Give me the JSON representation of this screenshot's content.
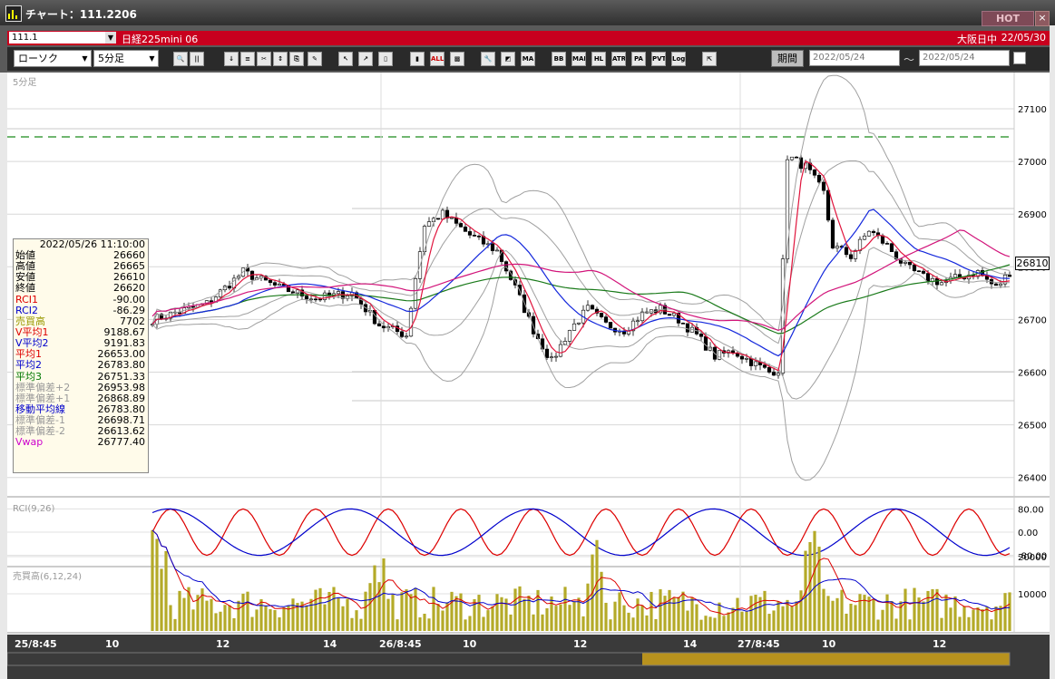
{
  "window": {
    "title": "チャート：111.2206",
    "hot_label": "HOT",
    "close_glyph": "×"
  },
  "symbol_bar": {
    "code": "111.1",
    "name": "日経225mini 06",
    "market": "大阪日中",
    "date": "22/05/30"
  },
  "toolbar": {
    "chart_type": "ローソク",
    "interval": "5分足",
    "buttons": [
      {
        "name": "zoom-icon",
        "label": "🔍"
      },
      {
        "name": "bar-width-icon",
        "label": "||"
      },
      {
        "name": "draw-down-icon",
        "label": "↓"
      },
      {
        "name": "scale-icon",
        "label": "≡"
      },
      {
        "name": "cut-icon",
        "label": "✂"
      },
      {
        "name": "mark-icon",
        "label": "↕"
      },
      {
        "name": "copy-icon",
        "label": "⎘"
      },
      {
        "name": "pencil-icon",
        "label": "✎"
      },
      {
        "name": "cursor-icon",
        "label": "↖"
      },
      {
        "name": "arrow-icon",
        "label": "↗"
      },
      {
        "name": "candle-a-icon",
        "label": "▯"
      },
      {
        "name": "candle-b-icon",
        "label": "▮"
      },
      {
        "name": "all-button",
        "label": "ALL"
      },
      {
        "name": "pattern-icon",
        "label": "▩"
      },
      {
        "name": "wrench-icon",
        "label": "🔧"
      },
      {
        "name": "color-icon",
        "label": "◩"
      },
      {
        "name": "ma-button",
        "label": "MA"
      },
      {
        "name": "bb-button",
        "label": "BB"
      },
      {
        "name": "mae-button",
        "label": "MAE"
      },
      {
        "name": "hl-button",
        "label": "HL"
      },
      {
        "name": "atr-button",
        "label": "ATR"
      },
      {
        "name": "para-button",
        "label": "PA"
      },
      {
        "name": "pvt-button",
        "label": "PVT"
      },
      {
        "name": "log-button",
        "label": "Log"
      },
      {
        "name": "export-icon",
        "label": "⇱"
      }
    ],
    "period_label": "期間",
    "date_from": "2022/05/24",
    "date_to": "2022/05/24",
    "tilde": "～"
  },
  "main_panel": {
    "label": "5分足",
    "price_ticks": [
      "27100",
      "27000",
      "26900",
      "26800",
      "26700",
      "26600",
      "26500",
      "26400"
    ],
    "current_price": "26810"
  },
  "info_box": {
    "datetime": "2022/05/26 11:10:00",
    "rows": [
      {
        "label": "始値",
        "value": "26660",
        "color": "#000000"
      },
      {
        "label": "高値",
        "value": "26665",
        "color": "#000000"
      },
      {
        "label": "安値",
        "value": "26610",
        "color": "#000000"
      },
      {
        "label": "終値",
        "value": "26620",
        "color": "#000000"
      },
      {
        "label": "RCI1",
        "value": "-90.00",
        "color": "#dd0000"
      },
      {
        "label": "RCI2",
        "value": "-86.29",
        "color": "#0000cc"
      },
      {
        "label": "売買高",
        "value": "7702",
        "color": "#999900"
      },
      {
        "label": "V平均1",
        "value": "9188.67",
        "color": "#dd0000"
      },
      {
        "label": "V平均2",
        "value": "9191.83",
        "color": "#0000cc"
      },
      {
        "label": "平均1",
        "value": "26653.00",
        "color": "#dd0000"
      },
      {
        "label": "平均2",
        "value": "26783.80",
        "color": "#0000cc"
      },
      {
        "label": "平均3",
        "value": "26751.33",
        "color": "#007700"
      },
      {
        "label": "標準偏差+2",
        "value": "26953.98",
        "color": "#999999"
      },
      {
        "label": "標準偏差+1",
        "value": "26868.89",
        "color": "#999999"
      },
      {
        "label": "移動平均線",
        "value": "26783.80",
        "color": "#0000cc"
      },
      {
        "label": "標準偏差-1",
        "value": "26698.71",
        "color": "#999999"
      },
      {
        "label": "標準偏差-2",
        "value": "26613.62",
        "color": "#999999"
      },
      {
        "label": "Vwap",
        "value": "26777.40",
        "color": "#cc00cc"
      }
    ]
  },
  "rci_panel": {
    "label": "RCI(9,26)",
    "ticks": [
      "80.00",
      "0.00",
      "-80.00"
    ]
  },
  "volume_panel": {
    "label": "売買高(6,12,24)",
    "ticks": [
      "20000",
      "10000"
    ]
  },
  "x_axis": {
    "labels": [
      "25/8:45",
      "10",
      "12",
      "14",
      "26/8:45",
      "10",
      "12",
      "14",
      "27/8:45",
      "10",
      "12"
    ]
  },
  "colors": {
    "up": "#ffffff",
    "down": "#000000",
    "ma1": "#e0143c",
    "ma2": "#1428dc",
    "ma3": "#1a7a1a",
    "bb": "#a0a0a0",
    "vwap": "#d2147a",
    "volume": "#b4aa28",
    "dash": "#1a8a1a"
  },
  "chart_data": {
    "type": "candlestick",
    "ylim": [
      26380,
      27180
    ],
    "candles": []
  }
}
